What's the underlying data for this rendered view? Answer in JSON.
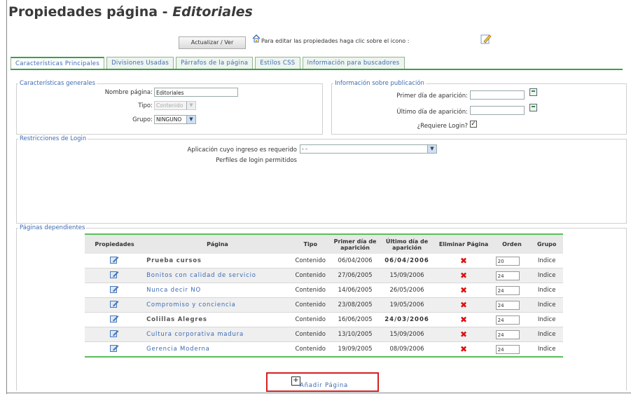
{
  "header": {
    "title_prefix": "Propiedades página - ",
    "title_name": "Editoriales"
  },
  "toolbar": {
    "update_button": "Actualizar / Ver",
    "edit_hint": "Para editar las propiedades haga clic sobre el icono :"
  },
  "tabs": [
    {
      "label": "Características Principales",
      "active": true
    },
    {
      "label": "Divisiones Usadas",
      "active": false
    },
    {
      "label": "Párrafos de la página",
      "active": false
    },
    {
      "label": "Estilos CSS",
      "active": false
    },
    {
      "label": "Información para buscadores",
      "active": false
    }
  ],
  "general": {
    "legend": "Características generales",
    "name_label": "Nombre página:",
    "name_value": "Editoriales",
    "type_label": "Tipo:",
    "type_value": "Contenido",
    "group_label": "Grupo:",
    "group_value": "NINGUNO"
  },
  "publication": {
    "legend": "Información sobre publicación",
    "first_day_label": "Primer día de aparición:",
    "first_day_value": "",
    "last_day_label": "Último día de aparición:",
    "last_day_value": "",
    "login_label": "¿Requiere Login?",
    "login_checked": true,
    "login_mark": "✓"
  },
  "login": {
    "legend": "Restricciones de Login",
    "app_label": "Aplicación cuyo ingreso es requerido",
    "app_value": "- -",
    "profiles_label": "Perfiles de login permitidos"
  },
  "dependent": {
    "legend": "Páginas dependientes",
    "columns": [
      "Propiedades",
      "Página",
      "Tipo",
      "Primer día de aparición",
      "Último día de aparición",
      "Eliminar Página",
      "Orden",
      "Grupo"
    ],
    "rows": [
      {
        "page": "Prueba cursos",
        "type": "Contenido",
        "first": "06/04/2006",
        "last": "06/04/2006",
        "last_expired": true,
        "order": "20",
        "group": "Indice",
        "gray": true
      },
      {
        "page": "Bonitos con calidad de servicio",
        "type": "Contenido",
        "first": "27/06/2005",
        "last": "15/09/2006",
        "last_expired": false,
        "order": "24",
        "group": "Indice",
        "gray": false
      },
      {
        "page": "Nunca decir NO",
        "type": "Contenido",
        "first": "14/06/2005",
        "last": "26/05/2006",
        "last_expired": false,
        "order": "24",
        "group": "Indice",
        "gray": false
      },
      {
        "page": "Compromiso y conciencia",
        "type": "Contenido",
        "first": "23/08/2005",
        "last": "19/05/2006",
        "last_expired": false,
        "order": "24",
        "group": "Indice",
        "gray": false
      },
      {
        "page": "Colillas Alegres",
        "type": "Contenido",
        "first": "16/06/2005",
        "last": "24/03/2006",
        "last_expired": true,
        "order": "24",
        "group": "Indice",
        "gray": true
      },
      {
        "page": "Cultura corporativa madura",
        "type": "Contenido",
        "first": "13/10/2005",
        "last": "15/09/2006",
        "last_expired": false,
        "order": "24",
        "group": "Indice",
        "gray": false
      },
      {
        "page": "Gerencia Moderna",
        "type": "Contenido",
        "first": "19/09/2005",
        "last": "08/09/2006",
        "last_expired": false,
        "order": "24",
        "group": "Indice",
        "gray": false
      }
    ],
    "delete_glyph": "✖",
    "add_label": "Añadir Página",
    "add_glyph": "+"
  },
  "colors": {
    "accent_green": "#3aa04a",
    "link_blue": "#3d6bb3",
    "expired_red": "#e02020",
    "highlight_red": "#d32020"
  }
}
